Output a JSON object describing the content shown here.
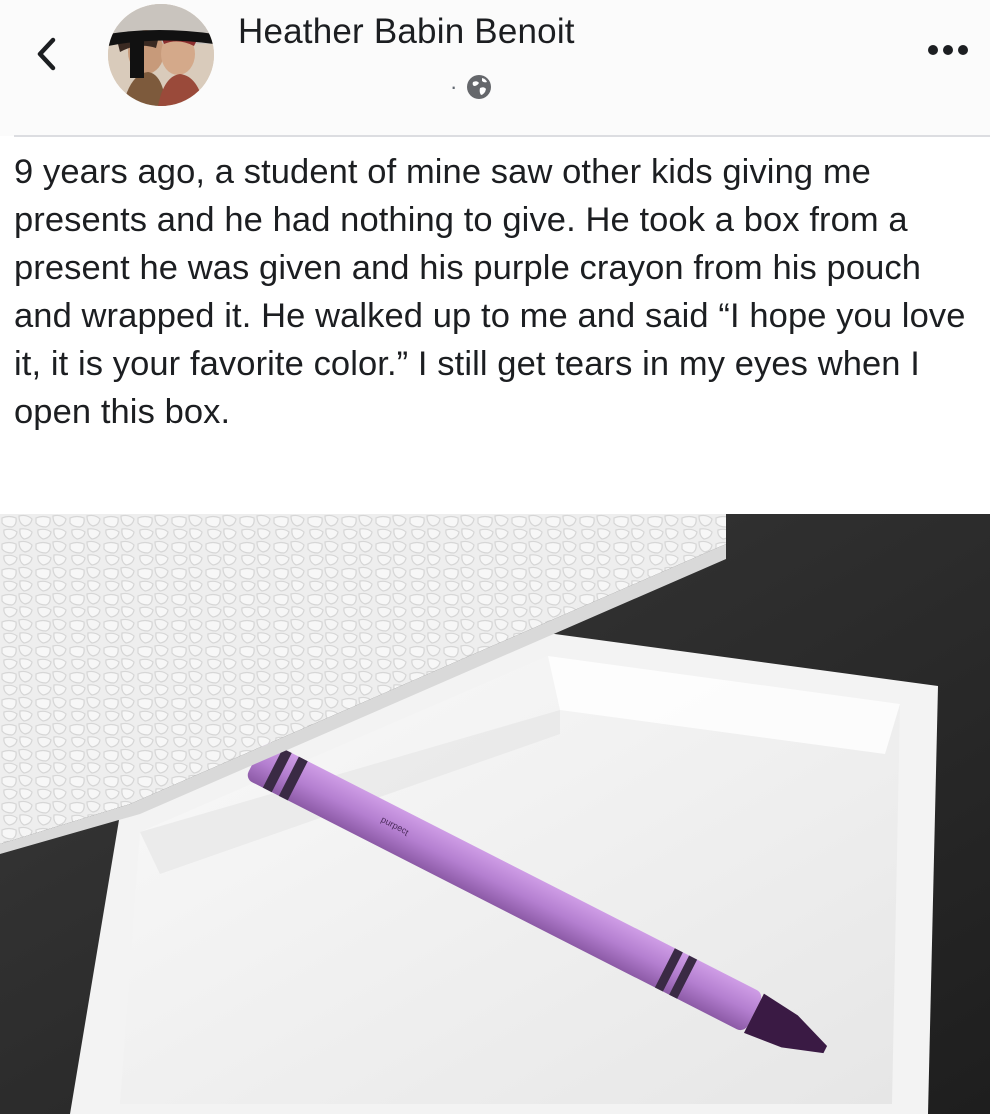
{
  "header": {
    "back_icon": "chevron-left-icon",
    "author_name": "Heather Babin Benoit",
    "meta_separator": "·",
    "privacy_icon": "globe-icon",
    "more_icon": "more-horizontal-icon"
  },
  "post": {
    "text": "9 years ago, a student of mine saw other kids giving me presents and he had nothing to give. He took a box from a present he was given and his purple crayon from his pouch and wrapped it. He walked up to me and said “I hope you love it, it is your favorite color.” I still get tears in my eyes when I open this box.",
    "photo": {
      "crayon_color": "#b47fd0",
      "crayon_tip_color": "#3a1a44",
      "box_color": "#f2f2f2",
      "background_color": "#2b2b2b"
    }
  },
  "colors": {
    "text": "#1c1e21",
    "meta": "#606770",
    "divider": "#dcdde1"
  }
}
